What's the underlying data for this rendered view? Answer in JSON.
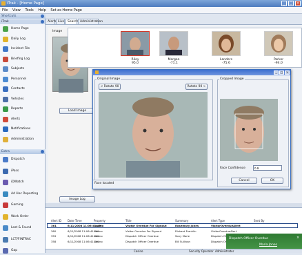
{
  "window": {
    "title": "iTrak - [Home Page]",
    "controls": [
      "_",
      "□",
      "×"
    ]
  },
  "menu": [
    "File",
    "View",
    "Tools",
    "Help",
    "Set as Home Page"
  ],
  "sidebar": {
    "shortcuts_header": "Shortcuts",
    "itrak_label": "iTrak",
    "items": [
      {
        "label": "Home Page",
        "icon": "home-icon",
        "color": "#4aa24a"
      },
      {
        "label": "Daily Log",
        "icon": "daily-log-icon",
        "color": "#e2b32c"
      },
      {
        "label": "Incident File",
        "icon": "incident-file-icon",
        "color": "#3f77c9"
      },
      {
        "label": "Briefing Log",
        "icon": "briefing-log-icon",
        "color": "#c84a3a"
      },
      {
        "label": "Subjects",
        "icon": "subjects-icon",
        "color": "#5a8ac8"
      },
      {
        "label": "Personnel",
        "icon": "personnel-icon",
        "color": "#4c8bd2"
      },
      {
        "label": "Contacts",
        "icon": "contacts-icon",
        "color": "#3a6fc0"
      },
      {
        "label": "Vehicles",
        "icon": "vehicles-icon",
        "color": "#4c6fa8"
      },
      {
        "label": "Reports",
        "icon": "reports-icon",
        "color": "#3a9a4a"
      },
      {
        "label": "Alerts",
        "icon": "alerts-icon",
        "color": "#d04a3a"
      },
      {
        "label": "Notifications",
        "icon": "notifications-icon",
        "color": "#2a6ac0"
      },
      {
        "label": "Administration",
        "icon": "administration-icon",
        "color": "#e0b03a"
      }
    ],
    "extra_header": "Extra",
    "extra_items": [
      {
        "label": "Dispatch",
        "icon": "dispatch-icon",
        "color": "#4a7ac8"
      },
      {
        "label": "iPass",
        "icon": "ipass-icon",
        "color": "#3c6ab0"
      },
      {
        "label": "iDWatch",
        "icon": "idwatch-icon",
        "color": "#6a5ab0"
      },
      {
        "label": "Ad Hoc Reporting",
        "icon": "ad-hoc-reporting-icon",
        "color": "#3a8ac0"
      },
      {
        "label": "Gaming",
        "icon": "gaming-icon",
        "color": "#c83a3a"
      },
      {
        "label": "Work Order",
        "icon": "work-order-icon",
        "color": "#e2b32c"
      },
      {
        "label": "Lost & Found",
        "icon": "lost-found-icon",
        "color": "#4a8ac8"
      },
      {
        "label": "LCT/FINTRAC",
        "icon": "lct-fintrac-icon",
        "color": "#4a7ab0"
      },
      {
        "label": "Gap",
        "icon": "gap-icon",
        "color": "#5a6ab0"
      }
    ]
  },
  "tabs": [
    "Alerts",
    "Live",
    "Search",
    "Administration"
  ],
  "image_panel": {
    "label": "Image",
    "load_button": "Load Image",
    "image_log_button": "Image Log"
  },
  "results": [
    {
      "name": "Riley",
      "score": "95.0"
    },
    {
      "name": "Morgan",
      "score": "-71.1"
    },
    {
      "name": "Landers",
      "score": "-75.6"
    },
    {
      "name": "Parker",
      "score": "-94.0"
    }
  ],
  "dialog": {
    "original_label": "Original Image",
    "rotate_left": "< Rotate 90",
    "rotate_right": "Rotate 90 >",
    "cropped_label": "Cropped Image",
    "confidence_label": "Face Confidence",
    "confidence_value": "0.9",
    "cancel": "Cancel",
    "ok": "OK",
    "status": "Face located"
  },
  "grid": {
    "headers": [
      "Alert ID",
      "Date Time",
      "Property",
      "Title",
      "Summary",
      "Alert Type",
      "Sent By"
    ],
    "rows": [
      [
        "361",
        "6/11/2008 11:06:41 AM",
        "Casino",
        "Visitor Overdue For Signout",
        "Rosemary Jones",
        "VisitorOverdueAlert",
        ""
      ],
      [
        "360",
        "6/11/2008 11:06:41 AM",
        "Casino",
        "Visitor Overdue For Signout",
        "Richard Franklin",
        "VisitorOverdueAlert",
        ""
      ],
      [
        "359",
        "6/11/2008 11:06:41 AM",
        "Casino",
        "Dispatch Officer Overdue",
        "Sony Marie",
        "Dispatch Officer Overdue",
        ""
      ],
      [
        "358",
        "6/11/2008 11:06:41 AM",
        "Casino",
        "Dispatch Officer Overdue",
        "Bill Sullivan",
        "Dispatch Officer Overdue",
        ""
      ]
    ]
  },
  "popup": {
    "title": "Dispatch Officer Overdue",
    "link": "Maria Jones"
  },
  "statusbar": {
    "property": "Casino",
    "role": "Security Operator",
    "user": "Administrator"
  }
}
